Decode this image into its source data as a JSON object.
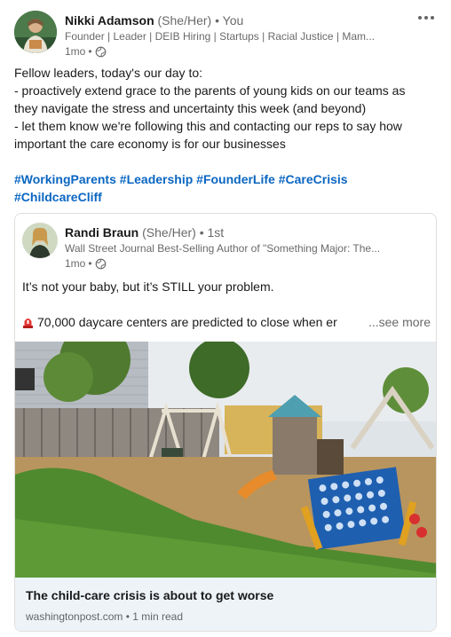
{
  "post": {
    "author": {
      "name": "Nikki Adamson",
      "pronouns": "(She/Her)",
      "separator": "•",
      "relationship": "You",
      "headline": "Founder | Leader | DEIB Hiring | Startups | Racial Justice | Mam...",
      "time": "1mo",
      "time_separator": "•",
      "visibility_icon": "globe-icon"
    },
    "more_icon": "ellipsis-icon",
    "body_lines": [
      "Fellow leaders, today's our day to:",
      "- proactively extend grace to the parents of young kids on our teams as",
      "they navigate the stress and uncertainty this week (and beyond)",
      "- let them know we're following this and contacting our reps to say how",
      "important the care economy is for our businesses"
    ],
    "hashtags": [
      "#WorkingParents",
      "#Leadership",
      "#FounderLife",
      "#CareCrisis",
      "#ChildcareCliff"
    ]
  },
  "shared": {
    "author": {
      "name": "Randi Braun",
      "pronouns": "(She/Her)",
      "separator": "•",
      "degree": "1st",
      "headline": "Wall Street Journal Best-Selling Author of \"Something Major: The...",
      "time": "1mo",
      "time_separator": "•",
      "visibility_icon": "globe-icon"
    },
    "text_line1": "It’s not your baby, but it’s STILL your problem.",
    "text_line2": "70,000 daycare centers are predicted to close when er",
    "see_more": "...see more",
    "siren_icon": "siren-icon",
    "article": {
      "title": "The child-care crisis is about to get worse",
      "source": "washingtonpost.com",
      "source_separator": "•",
      "read_time": "1 min read"
    }
  },
  "colors": {
    "link_blue": "#0a66c2",
    "muted_text": "#666666",
    "card_border": "#e0dfdc",
    "article_footer_bg": "#eef3f8"
  }
}
